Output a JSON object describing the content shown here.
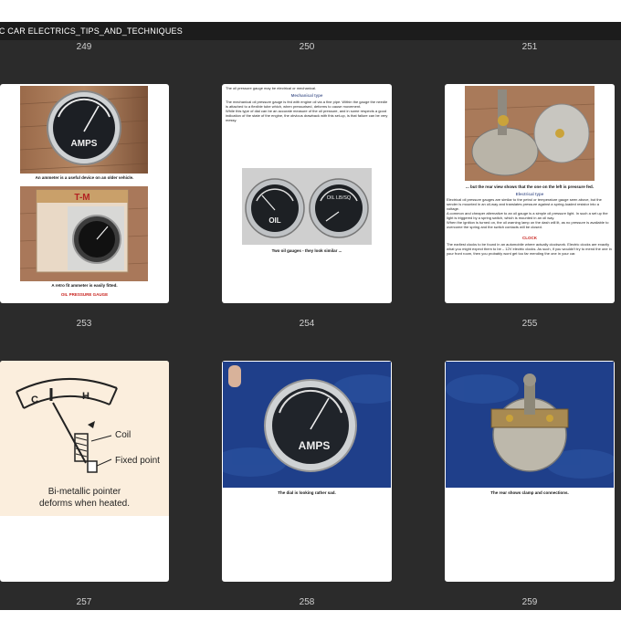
{
  "window": {
    "title": "SIC CAR ELECTRICS_TIPS_AND_TECHNIQUES"
  },
  "page_numbers": [
    "249",
    "250",
    "251",
    "253",
    "254",
    "255",
    "257",
    "258",
    "259"
  ],
  "pages": {
    "p1": {
      "caption1": "An ammeter is a useful device on an older vehicle.",
      "caption2": "A retro fit ammeter is easily fitted.",
      "heading": "OIL PRESSURE GAUGE",
      "gauge_label": "AMPS",
      "box_label": "T-M"
    },
    "p2": {
      "intro": "The oil pressure gauge may be electrical or mechanical.",
      "subhead": "Mechanical type",
      "body1": "The mechanical oil pressure gauge is fed with engine oil via a fine pipe. Within the gauge the needle is attached to a flexible tube which, when pressurised, deforms to cause movement.",
      "body2": "While this type of dial can be an accurate measure of the oil pressure, and in some respects a good indication of the state of the engine, the obvious drawback with this set-up, is that failure can be very messy.",
      "caption": "Two oil gauges - they look similar ...",
      "gauge_left": "OIL",
      "gauge_right": "OIL LB/SQ"
    },
    "p3": {
      "caption": "... but the rear view shows that the one on the left is pressure fed.",
      "subhead": "Electrical type",
      "body1": "Electrical oil pressure gauges are similar to the petrol or temperature gauge seen above, but the sender is mounted in an oil-way and translates pressure against a spring-loaded resistor into a voltage.",
      "body2": "A common and cheaper alternative to an oil gauge is a simple oil pressure light. In such a set up the light is triggered by a spring switch, which is mounted in an oil way.",
      "body3": "When the ignition is turned on, the oil warning lamp on the dash will lit, as no pressure is available to overcome the spring and the switch contacts will be closed.",
      "heading": "CLOCK",
      "body4": "The earliest clocks to be found in an automobile where actually clockwork. Electric clocks are exactly what you might expect them to be – 12V electric clocks. As such, if you wouldn't try to mend the one in your front room, then you probably wont get too far mending the one in your car."
    },
    "p4": {
      "label_coil": "Coil",
      "label_fixed": "Fixed point",
      "label_pointer": "Bi-metallic pointer",
      "label_deforms": "deforms when heated."
    },
    "p5": {
      "caption": "The dial is looking rather sad.",
      "gauge_label": "AMPS"
    },
    "p6": {
      "caption": "The rear shows clamp and connections."
    }
  },
  "colors": {
    "grid_bg": "#2b2b2b",
    "titlebar_bg": "#1c1c1c",
    "heading_red": "#c8231e",
    "subhead_blue": "#5a6a9a",
    "illus_bg": "#fbeedd"
  }
}
